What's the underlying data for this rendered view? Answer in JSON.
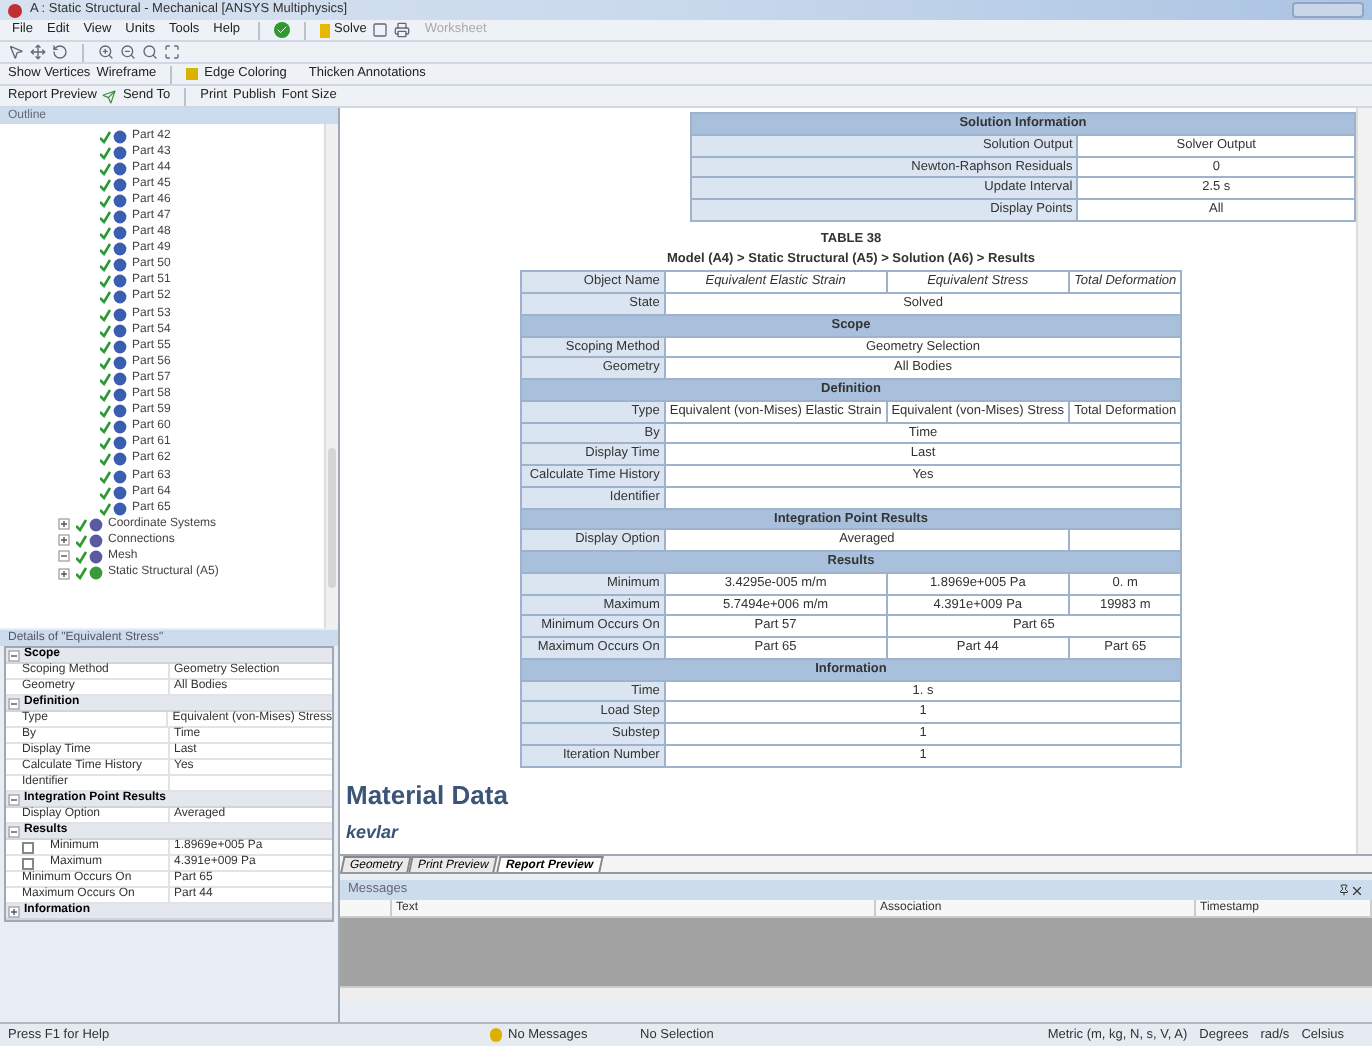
{
  "window": {
    "title": "A : Static Structural - Mechanical [ANSYS Multiphysics]"
  },
  "menu": [
    "File",
    "Edit",
    "View",
    "Units",
    "Tools",
    "Help"
  ],
  "toolbar": {
    "solve": "Solve",
    "worksheet": "Worksheet"
  },
  "graphics_toolbar": {
    "show_vertices": "Show Vertices",
    "wireframe": "Wireframe",
    "edge_coloring": "Edge Coloring",
    "thicken": "Thicken Annotations"
  },
  "report_toolbar": {
    "report_preview": "Report Preview",
    "send_to": "Send To",
    "print": "Print",
    "publish": "Publish",
    "font_size": "Font Size"
  },
  "outline": {
    "title": "Outline",
    "parts": [
      "Part 42",
      "Part 43",
      "Part 44",
      "Part 45",
      "Part 46",
      "Part 47",
      "Part 48",
      "Part 49",
      "Part 50",
      "Part 51",
      "Part 52",
      "Part 53",
      "Part 54",
      "Part 55",
      "Part 56",
      "Part 57",
      "Part 58",
      "Part 59",
      "Part 60",
      "Part 61",
      "Part 62",
      "Part 63",
      "Part 64",
      "Part 65"
    ],
    "items": [
      {
        "label": "Coordinate Systems",
        "expanded": false
      },
      {
        "label": "Connections",
        "expanded": false
      },
      {
        "label": "Mesh",
        "expanded": true
      },
      {
        "label": "Static Structural (A5)",
        "expanded": false
      }
    ]
  },
  "details": {
    "title": "Details of \"Equivalent Stress\"",
    "rows": [
      {
        "kind": "section",
        "label": "Scope",
        "expanded": true
      },
      {
        "kind": "row",
        "label": "Scoping Method",
        "value": "Geometry Selection"
      },
      {
        "kind": "row",
        "label": "Geometry",
        "value": "All Bodies"
      },
      {
        "kind": "section",
        "label": "Definition",
        "expanded": true
      },
      {
        "kind": "row",
        "label": "Type",
        "value": "Equivalent (von-Mises) Stress"
      },
      {
        "kind": "row",
        "label": "By",
        "value": "Time"
      },
      {
        "kind": "row",
        "label": "Display Time",
        "value": "Last"
      },
      {
        "kind": "row",
        "label": "Calculate Time History",
        "value": "Yes"
      },
      {
        "kind": "row",
        "label": "Identifier"
      },
      {
        "kind": "section",
        "label": "Integration Point Results",
        "expanded": true
      },
      {
        "kind": "row",
        "label": "Display Option",
        "value": "Averaged"
      },
      {
        "kind": "section",
        "label": "Results",
        "expanded": true
      },
      {
        "kind": "check",
        "label": "Minimum",
        "value": "1.8969e+005 Pa",
        "checked": false
      },
      {
        "kind": "check",
        "label": "Maximum",
        "value": "4.391e+009 Pa",
        "checked": false
      },
      {
        "kind": "row",
        "label": "Minimum Occurs On",
        "value": "Part 65"
      },
      {
        "kind": "row",
        "label": "Maximum Occurs On",
        "value": "Part 44"
      },
      {
        "kind": "section",
        "label": "Information",
        "expanded": false
      }
    ]
  },
  "solution_information": {
    "title": "Solution Information",
    "rows": [
      [
        "Solution Output",
        "Solver Output"
      ],
      [
        "Newton-Raphson Residuals",
        "0"
      ],
      [
        "Update Interval",
        "2.5 s"
      ],
      [
        "Display Points",
        "All"
      ]
    ]
  },
  "results_table": {
    "number": "TABLE 38",
    "caption": "Model (A4) > Static Structural (A5) > Solution (A6) > Results",
    "rows": [
      {
        "kind": "names",
        "label": "Object Name",
        "cells": [
          "Equivalent Elastic Strain",
          "Equivalent Stress",
          "Total Deformation"
        ]
      },
      {
        "kind": "row",
        "label": "State",
        "cells": [
          "Solved"
        ]
      },
      {
        "kind": "section",
        "label": "Scope"
      },
      {
        "kind": "row",
        "label": "Scoping Method",
        "cells": [
          "Geometry Selection"
        ]
      },
      {
        "kind": "row",
        "label": "Geometry",
        "cells": [
          "All Bodies"
        ]
      },
      {
        "kind": "section",
        "label": "Definition"
      },
      {
        "kind": "row",
        "label": "Type",
        "cells": [
          "Equivalent (von-Mises) Elastic Strain",
          "Equivalent (von-Mises) Stress",
          "Total Deformation"
        ]
      },
      {
        "kind": "row",
        "label": "By",
        "cells": [
          "Time"
        ]
      },
      {
        "kind": "row",
        "label": "Display Time",
        "cells": [
          "Last"
        ]
      },
      {
        "kind": "row",
        "label": "Calculate Time History",
        "cells": [
          "Yes"
        ]
      },
      {
        "kind": "row",
        "label": "Identifier",
        "cells": []
      },
      {
        "kind": "section",
        "label": "Integration Point Results"
      },
      {
        "kind": "shared_left",
        "label": "Display Option",
        "cells": [
          "Averaged"
        ]
      },
      {
        "kind": "section",
        "label": "Results"
      },
      {
        "kind": "row",
        "label": "Minimum",
        "cells": [
          "3.4295e-005 m/m",
          "1.8969e+005 Pa",
          "0. m"
        ]
      },
      {
        "kind": "row",
        "label": "Maximum",
        "cells": [
          "5.7494e+006 m/m",
          "4.391e+009 Pa",
          "19983 m"
        ]
      },
      {
        "kind": "shared_right",
        "label": "Minimum Occurs On",
        "cells": [
          "Part 57",
          "Part 65"
        ]
      },
      {
        "kind": "row",
        "label": "Maximum Occurs On",
        "cells": [
          "Part 65",
          "Part 44",
          "Part 65"
        ]
      },
      {
        "kind": "section",
        "label": "Information"
      },
      {
        "kind": "row",
        "label": "Time",
        "cells": [
          "1. s"
        ]
      },
      {
        "kind": "row",
        "label": "Load Step",
        "cells": [
          "1"
        ]
      },
      {
        "kind": "row",
        "label": "Substep",
        "cells": [
          "1"
        ]
      },
      {
        "kind": "row",
        "label": "Iteration Number",
        "cells": [
          "1"
        ]
      }
    ]
  },
  "material_heading": "Material Data",
  "material_name": "kevlar",
  "tabs": [
    {
      "label": "Geometry",
      "selected": false
    },
    {
      "label": "Print Preview",
      "selected": false
    },
    {
      "label": "Report Preview",
      "selected": true
    }
  ],
  "messages": {
    "title": "Messages",
    "columns": [
      "Text",
      "Association",
      "Timestamp"
    ]
  },
  "status_bar": {
    "help": "Press F1 for Help",
    "messages": "No Messages",
    "selection": "No Selection",
    "units": "Metric (m, kg, N, s, V, A)",
    "angle": "Degrees",
    "rotation": "rad/s",
    "temperature": "Celsius"
  }
}
